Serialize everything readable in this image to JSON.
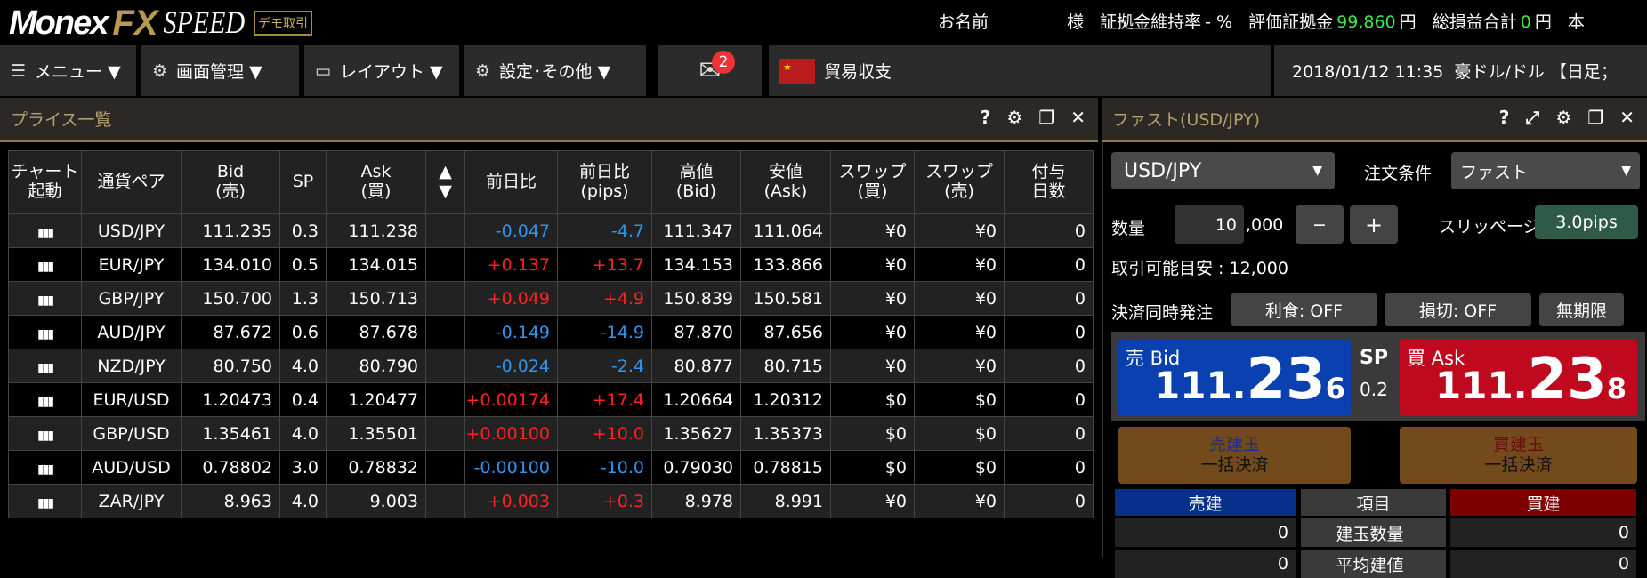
{
  "brand": {
    "name": "Monex",
    "fx": "FX",
    "speed": "SPEED",
    "demo": "デモ取引"
  },
  "account": {
    "name": "お名前",
    "sama": "様",
    "margin_ratio_label": "証拠金維持率",
    "margin_ratio": "- %",
    "equity_label": "評価証拠金",
    "equity": "99,860",
    "equity_unit": "円",
    "pl_label": "総損益合計",
    "pl": "0",
    "pl_unit": "円",
    "more": "本"
  },
  "menu": {
    "menu": "メニュー ▼",
    "screen": "画面管理 ▼",
    "layout": "レイアウト ▼",
    "settings": "設定･その他 ▼",
    "mail_count": "2",
    "news": "貿易収支",
    "ticker": "2018/01/12 11:35  豪ドル/ドル 【日足；"
  },
  "price_panel": {
    "title": "プライス一覧",
    "headers": [
      "チャート\n起動",
      "通貨ペア",
      "Bid\n(売)",
      "SP",
      "Ask\n(買)",
      "▲\n▼",
      "前日比",
      "前日比\n(pips)",
      "高値\n(Bid)",
      "安値\n(Ask)",
      "スワップ\n(買)",
      "スワップ\n(売)",
      "付与\n日数"
    ],
    "rows": [
      [
        "USD/JPY",
        "111.235",
        "0.3",
        "111.238",
        "-0.047",
        "-4.7",
        "111.347",
        "111.064",
        "¥0",
        "¥0",
        "0",
        "dn"
      ],
      [
        "EUR/JPY",
        "134.010",
        "0.5",
        "134.015",
        "+0.137",
        "+13.7",
        "134.153",
        "133.866",
        "¥0",
        "¥0",
        "0",
        "up"
      ],
      [
        "GBP/JPY",
        "150.700",
        "1.3",
        "150.713",
        "+0.049",
        "+4.9",
        "150.839",
        "150.581",
        "¥0",
        "¥0",
        "0",
        "up"
      ],
      [
        "AUD/JPY",
        "87.672",
        "0.6",
        "87.678",
        "-0.149",
        "-14.9",
        "87.870",
        "87.656",
        "¥0",
        "¥0",
        "0",
        "dn"
      ],
      [
        "NZD/JPY",
        "80.750",
        "4.0",
        "80.790",
        "-0.024",
        "-2.4",
        "80.877",
        "80.715",
        "¥0",
        "¥0",
        "0",
        "dn"
      ],
      [
        "EUR/USD",
        "1.20473",
        "0.4",
        "1.20477",
        "+0.00174",
        "+17.4",
        "1.20664",
        "1.20312",
        "$0",
        "$0",
        "0",
        "up"
      ],
      [
        "GBP/USD",
        "1.35461",
        "4.0",
        "1.35501",
        "+0.00100",
        "+10.0",
        "1.35627",
        "1.35373",
        "$0",
        "$0",
        "0",
        "up"
      ],
      [
        "AUD/USD",
        "0.78802",
        "3.0",
        "0.78832",
        "-0.00100",
        "-10.0",
        "0.79030",
        "0.78815",
        "$0",
        "$0",
        "0",
        "dn"
      ],
      [
        "ZAR/JPY",
        "8.963",
        "4.0",
        "9.003",
        "+0.003",
        "+0.3",
        "8.978",
        "8.991",
        "¥0",
        "¥0",
        "0",
        "up"
      ]
    ]
  },
  "fast_panel": {
    "title": "ファスト(USD/JPY)",
    "pair": "USD/JPY",
    "order_cond_label": "注文条件",
    "order_cond": "ファスト",
    "qty_label": "数量",
    "qty": "10",
    "qty_suffix": ",000",
    "minus": "−",
    "plus": "+",
    "slippage_label": "スリッページ",
    "slippage": "3.0pips",
    "available": "取引可能目安 : 12,000",
    "settle_label": "決済同時発注",
    "take_profit": "利食: OFF",
    "stop_loss": "損切: OFF",
    "expiry": "無期限",
    "bid_label": "売 Bid",
    "bid_a": "111.",
    "bid_b": "23",
    "bid_c": "6",
    "sp_label": "SP",
    "sp": "0.2",
    "ask_label": "買 Ask",
    "ask_a": "111.",
    "ask_b": "23",
    "ask_c": "8",
    "close_sell_1": "売建玉",
    "close_sell_2": "一括決済",
    "close_buy_1": "買建玉",
    "close_buy_2": "一括決済",
    "pos_headers": [
      "売建",
      "項目",
      "買建"
    ],
    "pos_rows": [
      [
        "0",
        "建玉数量",
        "0"
      ],
      [
        "0",
        "平均建値",
        "0"
      ]
    ]
  },
  "colors": {
    "bid": "#0a40b0",
    "ask": "#c0081e",
    "gold": "#b79a4f",
    "up": "#ff2222",
    "down": "#2f96f0",
    "equity": "#3ee84f"
  }
}
